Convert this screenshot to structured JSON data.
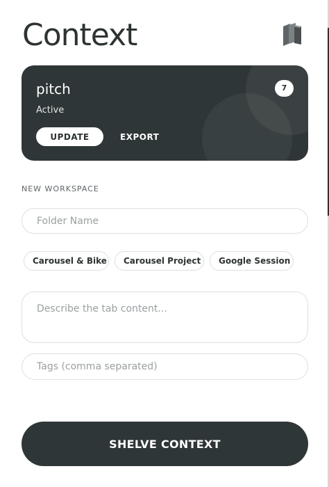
{
  "header": {
    "title": "Context",
    "shelf_icon": "books-icon"
  },
  "context_card": {
    "name": "pitch",
    "status": "Active",
    "tab_count": "7",
    "update_label": "UPDATE",
    "export_label": "EXPORT"
  },
  "new_workspace": {
    "section_label": "NEW WORKSPACE",
    "folder_placeholder": "Folder Name",
    "suggestions": [
      "Carousel & Bike",
      "Carousel Project",
      "Google Session"
    ],
    "description_placeholder": "Describe the tab content...",
    "tags_placeholder": "Tags (comma separated)"
  },
  "actions": {
    "shelve_label": "SHELVE CONTEXT"
  },
  "colors": {
    "dark": "#2f3637",
    "text": "#2d3233",
    "border": "#dcdfe0"
  }
}
